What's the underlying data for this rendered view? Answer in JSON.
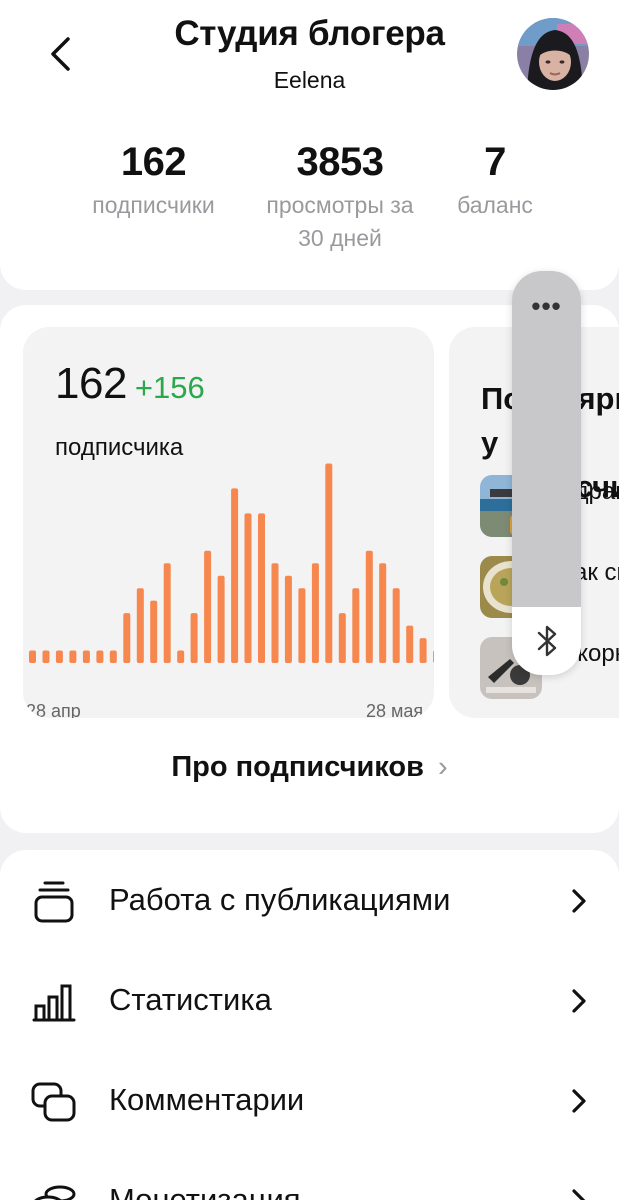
{
  "header": {
    "title": "Студия блогера",
    "subtitle": "Eelena",
    "back_icon": "chevron-left-icon",
    "avatar_icon": "user-avatar"
  },
  "stats": [
    {
      "value": "162",
      "label": "подписчики"
    },
    {
      "value": "3853",
      "label": "просмотры за 30 дней"
    },
    {
      "value": "7",
      "label": "баланс"
    }
  ],
  "subscribers_tile": {
    "count": "162",
    "delta": "+156",
    "caption": "подписчика",
    "x_start": "28 апр",
    "x_end": "28 мая",
    "accent_color": "#f5874f",
    "delta_color": "#2aa84a"
  },
  "chart_data": {
    "type": "bar",
    "title": "",
    "xlabel": "",
    "ylabel": "",
    "categories": [
      "28 апр",
      "",
      "",
      "",
      "",
      "",
      "",
      "",
      "",
      "",
      "",
      "",
      "",
      "",
      "",
      "",
      "",
      "",
      "",
      "",
      "",
      "",
      "",
      "",
      "",
      "",
      "",
      "",
      "",
      "",
      "28 мая"
    ],
    "values": [
      1,
      1,
      1,
      1,
      1,
      1,
      1,
      4,
      6,
      5,
      8,
      1,
      4,
      9,
      7,
      14,
      12,
      12,
      8,
      7,
      6,
      8,
      16,
      4,
      6,
      9,
      8,
      6,
      3,
      2,
      1
    ],
    "ylim": [
      0,
      17
    ],
    "grid": false
  },
  "popular_tile": {
    "title": "Популярное у подписчиков",
    "items": [
      {
        "text": "Здравствуйте",
        "thumb_icon": "sea-thumbnail"
      },
      {
        "text": "Как сн",
        "thumb_icon": "food-thumbnail"
      },
      {
        "text": "Икорные своими",
        "thumb_icon": "tools-thumbnail"
      }
    ]
  },
  "overlay": {
    "menu_icon": "more-dots-icon",
    "bt_icon": "bluetooth-icon",
    "dots": "•••"
  },
  "about_link": {
    "label": "Про подписчиков",
    "chevron": "›"
  },
  "menu": [
    {
      "label": "Работа с публикациями",
      "icon": "publications-icon"
    },
    {
      "label": "Статистика",
      "icon": "statistics-icon"
    },
    {
      "label": "Комментарии",
      "icon": "comments-icon"
    },
    {
      "label": "Монетизация",
      "icon": "monetization-icon"
    }
  ]
}
